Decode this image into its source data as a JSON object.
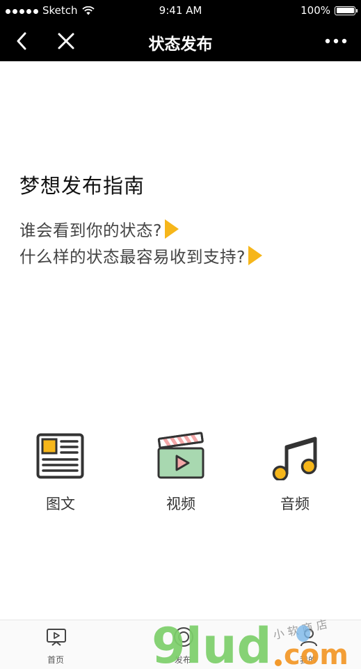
{
  "status_bar": {
    "carrier": "Sketch",
    "time": "9:41 AM",
    "battery": "100%"
  },
  "nav": {
    "title": "状态发布"
  },
  "guide": {
    "title": "梦想发布指南",
    "links": [
      "谁会看到你的状态?",
      "什么样的状态最容易收到支持?"
    ]
  },
  "publish_options": [
    {
      "label": "图文",
      "icon": "article-icon"
    },
    {
      "label": "视频",
      "icon": "video-clapper-icon"
    },
    {
      "label": "音频",
      "icon": "music-note-icon"
    }
  ],
  "tabbar": {
    "items": [
      {
        "label": "首页",
        "icon": "tv-icon"
      },
      {
        "label": "发布",
        "icon": "publish-icon"
      },
      {
        "label": "我的",
        "icon": "profile-icon"
      }
    ]
  },
  "watermark": {
    "text": "9lud.com",
    "sub": "小 软 商 店"
  },
  "colors": {
    "accent": "#f6b61a",
    "bar": "#000000",
    "video_green": "#a8d8b0",
    "audio_pink": "#f4a7a8",
    "watermark_green": "#7dcf6a",
    "watermark_orange": "#f39a2c"
  }
}
